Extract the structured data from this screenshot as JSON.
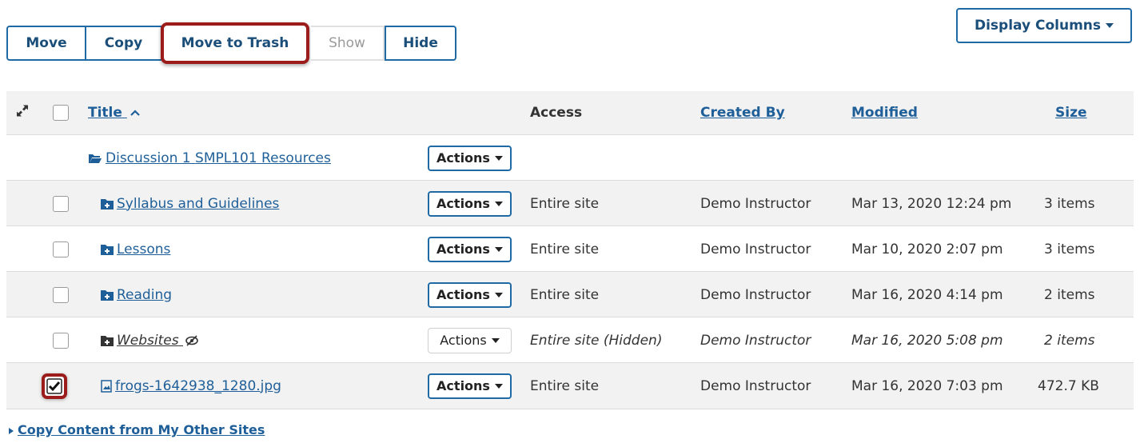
{
  "toolbar": {
    "move": "Move",
    "copy": "Copy",
    "trash": "Move to Trash",
    "show": "Show",
    "hide": "Hide"
  },
  "display_columns": "Display Columns",
  "headers": {
    "title": "Title",
    "access": "Access",
    "created_by": "Created By",
    "modified": "Modified",
    "size": "Size"
  },
  "parent_folder": {
    "title": "Discussion 1 SMPL101 Resources",
    "actions": "Actions"
  },
  "rows": [
    {
      "title": "Syllabus and Guidelines",
      "actions": "Actions",
      "access": "Entire site",
      "created_by": "Demo Instructor",
      "modified": "Mar 13, 2020 12:24 pm",
      "size": "3 items",
      "icon": "folder-plus-icon"
    },
    {
      "title": "Lessons",
      "actions": "Actions",
      "access": "Entire site",
      "created_by": "Demo Instructor",
      "modified": "Mar 10, 2020 2:07 pm",
      "size": "3 items",
      "icon": "folder-plus-icon"
    },
    {
      "title": "Reading",
      "actions": "Actions",
      "access": "Entire site",
      "created_by": "Demo Instructor",
      "modified": "Mar 16, 2020 4:14 pm",
      "size": "2 items",
      "icon": "folder-plus-icon"
    },
    {
      "title": "Websites",
      "actions": "Actions",
      "access": "Entire site (Hidden)",
      "created_by": "Demo Instructor",
      "modified": "Mar 16, 2020 5:08 pm",
      "size": "2 items",
      "icon": "folder-plus-icon"
    },
    {
      "title": "frogs-1642938_1280.jpg",
      "actions": "Actions",
      "access": "Entire site",
      "created_by": "Demo Instructor",
      "modified": "Mar 16, 2020 7:03 pm",
      "size": "472.7 KB",
      "icon": "image-file-icon"
    }
  ],
  "footer_link": "Copy Content from My Other Sites",
  "colors": {
    "accent": "#1f6aa5",
    "highlight": "#9c1c1c"
  }
}
